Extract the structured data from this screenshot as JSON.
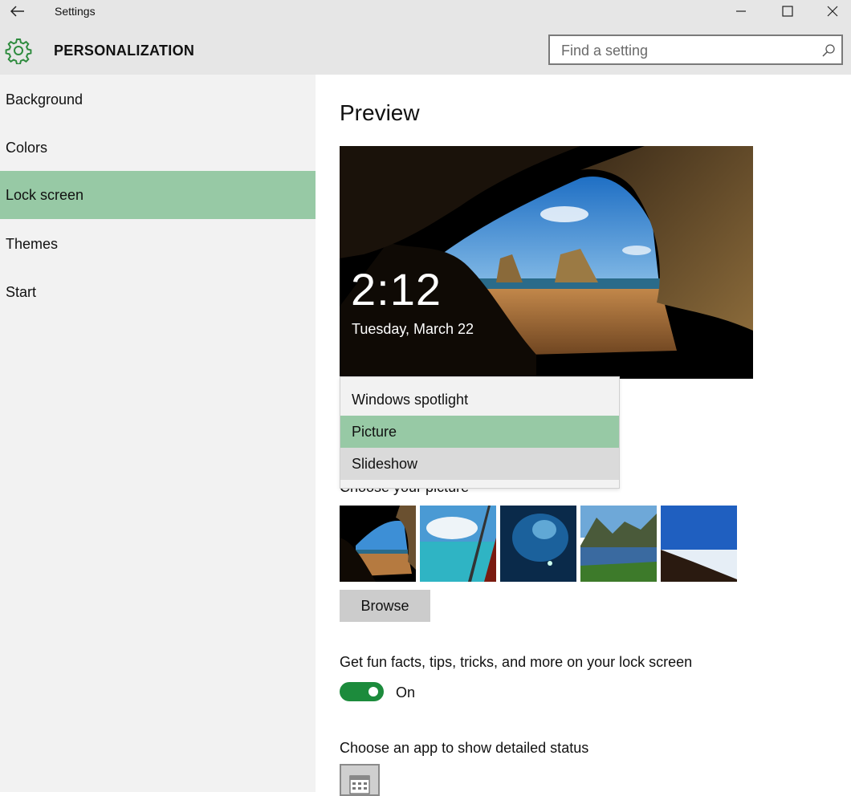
{
  "window": {
    "title": "Settings"
  },
  "header": {
    "section": "PERSONALIZATION",
    "search_placeholder": "Find a setting"
  },
  "sidebar": {
    "items": [
      {
        "label": "Background"
      },
      {
        "label": "Colors"
      },
      {
        "label": "Lock screen",
        "active": true
      },
      {
        "label": "Themes"
      },
      {
        "label": "Start"
      }
    ]
  },
  "main": {
    "preview_heading": "Preview",
    "preview": {
      "time": "2:12",
      "date": "Tuesday, March 22"
    },
    "background_dropdown": {
      "options": [
        {
          "label": "Windows spotlight"
        },
        {
          "label": "Picture",
          "selected": true
        },
        {
          "label": "Slideshow"
        }
      ]
    },
    "choose_picture_label": "Choose your picture",
    "browse_label": "Browse",
    "tips_label": "Get fun facts, tips, tricks, and more on your lock screen",
    "tips_toggle": {
      "state_label": "On",
      "on": true
    },
    "detailed_status_label": "Choose an app to show detailed status"
  },
  "colors": {
    "accent": "#97c9a5",
    "toggle_on": "#1c8b3c",
    "chrome": "#e6e6e6",
    "sidebar": "#f2f2f2"
  },
  "icons": [
    "back-arrow-icon",
    "minimize-icon",
    "maximize-icon",
    "close-icon",
    "gear-icon",
    "search-icon",
    "calendar-icon"
  ]
}
